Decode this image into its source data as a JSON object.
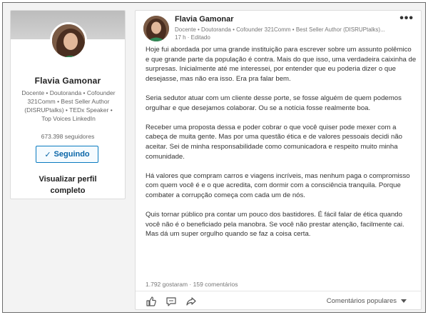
{
  "profile": {
    "name": "Flavia Gamonar",
    "headline": "Docente • Doutoranda • Cofounder 321Comm • Best Seller Author (DISRUPtalks) • TEDx Speaker • Top Voices LinkedIn",
    "followers": "673.398 seguidores",
    "follow_label": "Seguindo",
    "view_profile": "Visualizar perfil completo"
  },
  "post": {
    "author": "Flavia Gamonar",
    "author_headline": "Docente • Doutoranda • Cofounder 321Comm • Best Seller Author (DISRUPtalks)...",
    "meta": "17 h · Editado",
    "paragraphs": [
      "Hoje fui abordada por uma grande instituição para escrever sobre um assunto polêmico e que grande parte da população é contra. Mais do que isso, uma verdadeira caixinha de surpresas. Inicialmente até me interessei, por entender que eu poderia dizer o que desejasse, mas não era isso. Era pra falar bem.",
      "Seria sedutor atuar com um cliente desse porte, se fosse alguém de quem podemos orgulhar e que desejamos colaborar. Ou se a notícia fosse realmente boa.",
      "Receber uma proposta dessa e poder cobrar o que você quiser pode mexer com a cabeça de muita gente. Mas por uma questão ética e de valores pessoais decidi não aceitar.  Sei de minha responsabilidade como comunicadora e respeito muito minha comunidade.",
      "Há valores que compram carros e viagens incríveis, mas nenhum paga o compromisso com quem você é e o que acredita, com dormir com a consciência tranquila. Porque combater a corrupção começa com cada um de nós.",
      "Quis tornar público pra contar um pouco dos bastidores. É fácil falar de ética quando você não é o beneficiado pela manobra. Se você não prestar atenção, facilmente cai. Mas dá um super orgulho quando se faz a coisa certa."
    ],
    "stats": "1.792 gostaram · 159 comentários",
    "comments_sort": "Comentários populares"
  },
  "icons": {
    "like": "thumbs-up-icon",
    "comment": "comment-icon",
    "share": "share-icon",
    "more": "more-icon"
  },
  "colors": {
    "accent": "#0a66a8"
  }
}
